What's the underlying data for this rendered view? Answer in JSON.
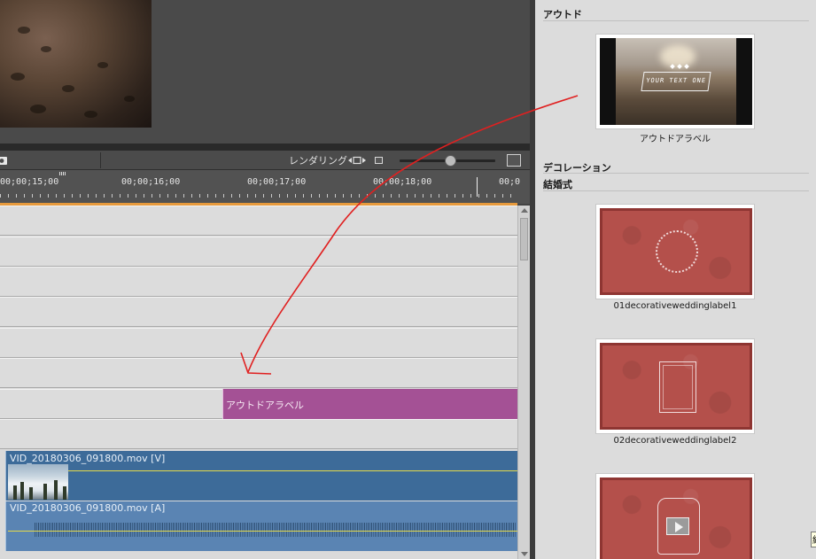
{
  "timeline": {
    "toolbar": {
      "render_label": "レンダリング"
    },
    "ruler": {
      "timecodes": [
        "00;00;15;00",
        "00;00;16;00",
        "00;00;17;00",
        "00;00;18;00",
        "00;0"
      ]
    },
    "clips": {
      "title_clip": "アウトドアラベル",
      "video_clip": "VID_20180306_091800.mov [V]",
      "audio_clip": "VID_20180306_091800.mov [A]"
    }
  },
  "library": {
    "categories": {
      "outdoor": "アウトド",
      "decoration": "デコレーション",
      "wedding": "結婚式"
    },
    "items": [
      {
        "name": "アウトドアラベル",
        "badge_text": "YOUR TEXT ONE"
      },
      {
        "name": "01decorativeweddinglabel1"
      },
      {
        "name": "02decorativeweddinglabel2"
      }
    ],
    "tooltip": "結"
  },
  "colors": {
    "title_clip": "#a45195",
    "video_clip": "#3d6b99",
    "audio_clip": "#5a84b3",
    "work_area_bar": "#e79a3c",
    "annotation_arrow": "#e02020"
  }
}
